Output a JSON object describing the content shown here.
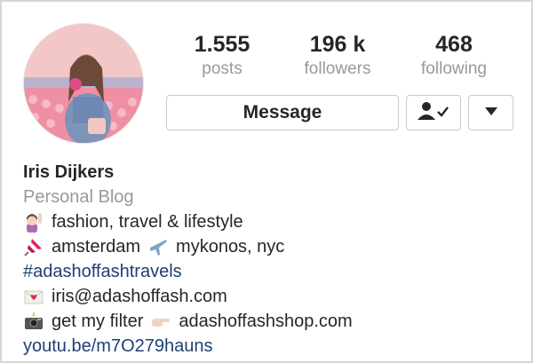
{
  "profile": {
    "stats": [
      {
        "number": "1.555",
        "label": "posts"
      },
      {
        "number": "196 k",
        "label": "followers"
      },
      {
        "number": "468",
        "label": "following"
      }
    ],
    "actions": {
      "message_label": "Message"
    },
    "bio": {
      "name": "Iris Dijkers",
      "category": "Personal Blog",
      "line1": "fashion, travel & lifestyle",
      "line2_a": "amsterdam",
      "line2_b": "mykonos, nyc",
      "hashtag": "#adashoffashtravels",
      "email": "iris@adashoffash.com",
      "line5_a": "get my filter",
      "line5_b": "adashoffashshop.com",
      "link": "youtu.be/m7O279hauns"
    }
  },
  "colors": {
    "link": "#1f3f73",
    "muted": "#999999",
    "border": "#c9c9c9"
  },
  "icons": {
    "follow": "person-check-icon",
    "dropdown": "caret-down-icon"
  }
}
